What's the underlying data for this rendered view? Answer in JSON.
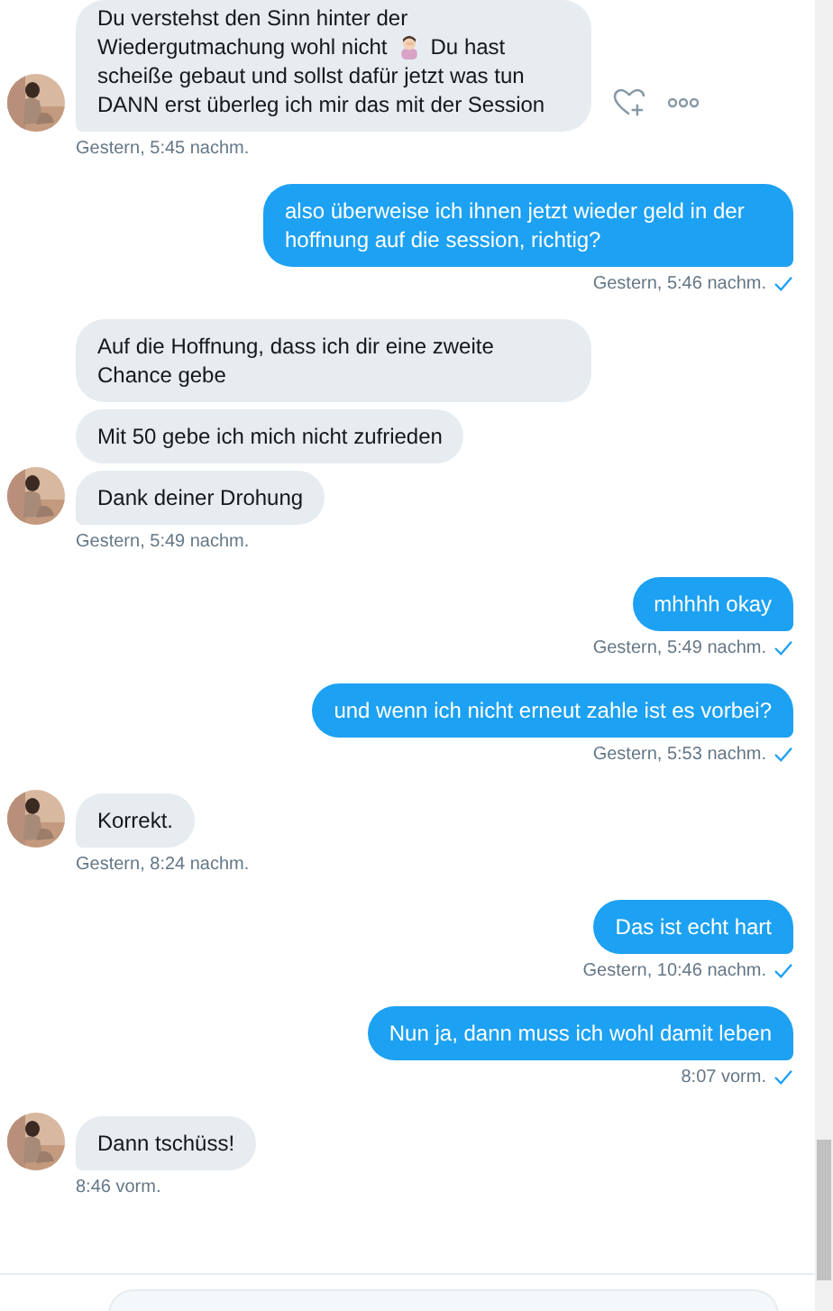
{
  "conversation": [
    {
      "kind": "received",
      "actions": true,
      "bubbles": [
        {
          "lines": [
            [
              "Du verstehst den Sinn hinter der"
            ],
            [
              "Wiedergutmachung wohl nicht",
              "Du hast"
            ],
            [
              "scheiße gebaut und sollst dafür jetzt was tun DANN erst überleg ich mir das mit der Session"
            ]
          ]
        }
      ],
      "time": "Gestern, 5:45 nachm."
    },
    {
      "kind": "sent",
      "actions": false,
      "bubbles": [
        {
          "lines": [
            [
              "also überweise ich ihnen jetzt wieder geld in der hoffnung auf die session, richtig?"
            ]
          ]
        }
      ],
      "time": "Gestern, 5:46 nachm."
    },
    {
      "kind": "received",
      "actions": false,
      "bubbles": [
        {
          "lines": [
            [
              "Auf die Hoffnung, dass ich dir eine zweite Chance gebe"
            ]
          ]
        },
        {
          "lines": [
            [
              "Mit 50 gebe ich mich nicht zufrieden"
            ]
          ]
        },
        {
          "lines": [
            [
              "Dank deiner Drohung"
            ]
          ]
        }
      ],
      "time": "Gestern, 5:49 nachm."
    },
    {
      "kind": "sent",
      "actions": false,
      "bubbles": [
        {
          "lines": [
            [
              "mhhhh okay"
            ]
          ]
        }
      ],
      "time": "Gestern, 5:49 nachm."
    },
    {
      "kind": "sent",
      "actions": false,
      "bubbles": [
        {
          "lines": [
            [
              "und wenn ich nicht erneut zahle ist es vorbei?"
            ]
          ]
        }
      ],
      "time": "Gestern, 5:53 nachm."
    },
    {
      "kind": "received",
      "actions": false,
      "bubbles": [
        {
          "lines": [
            [
              "Korrekt."
            ]
          ]
        }
      ],
      "time": "Gestern, 8:24 nachm."
    },
    {
      "kind": "sent",
      "actions": false,
      "bubbles": [
        {
          "lines": [
            [
              "Das ist echt hart"
            ]
          ]
        }
      ],
      "time": "Gestern, 10:46 nachm."
    },
    {
      "kind": "sent",
      "actions": false,
      "bubbles": [
        {
          "lines": [
            [
              "Nun ja, dann muss ich wohl damit leben"
            ]
          ]
        }
      ],
      "time": "8:07 vorm."
    },
    {
      "kind": "received",
      "actions": false,
      "bubbles": [
        {
          "lines": [
            [
              "Dann tschüss!"
            ]
          ]
        }
      ],
      "time": "8:46 vorm."
    }
  ]
}
